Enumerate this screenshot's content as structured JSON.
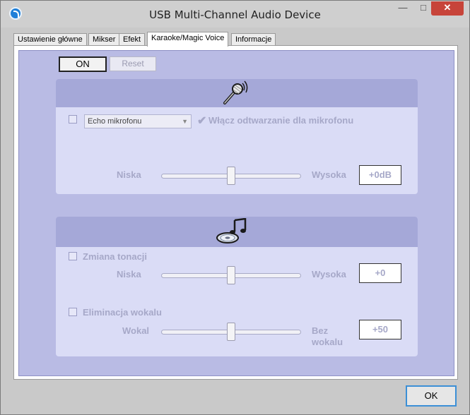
{
  "window": {
    "title": "USB Multi-Channel Audio Device",
    "minimize_glyph": "—",
    "maximize_glyph": "□",
    "close_glyph": "✕"
  },
  "tabs": [
    {
      "label": "Ustawienie główne",
      "active": false
    },
    {
      "label": "Mikser",
      "active": false
    },
    {
      "label": "Efekt",
      "active": false
    },
    {
      "label": "Karaoke/Magic Voice",
      "active": true
    },
    {
      "label": "Informacje",
      "active": false
    }
  ],
  "toolbar": {
    "on_label": "ON",
    "reset_label": "Reset"
  },
  "microphone_panel": {
    "icon": "microphone-icon",
    "echo_checked": false,
    "echo_select_value": "Echo mikrofonu",
    "playback_checked": true,
    "playback_label": "Włącz odtwarzanie dla mikrofonu",
    "slider_low_label": "Niska",
    "slider_high_label": "Wysoka",
    "slider_level": 0.5,
    "value_display": "+0dB"
  },
  "music_panel": {
    "icon": "music-cd-icon",
    "pitch_checked": false,
    "pitch_label": "Zmiana tonacji",
    "pitch_low_label": "Niska",
    "pitch_high_label": "Wysoka",
    "pitch_level": 0.5,
    "pitch_value": "+0",
    "vocal_checked": false,
    "vocal_label": "Eliminacja wokalu",
    "vocal_low_label": "Wokal",
    "vocal_high_label_1": "Bez",
    "vocal_high_label_2": "wokalu",
    "vocal_level": 0.5,
    "vocal_value": "+50"
  },
  "footer": {
    "ok_label": "OK"
  },
  "colors": {
    "accent": "#3c8fd6",
    "panel_header": "#a5a8d8",
    "panel_body": "#dadcf6",
    "content_bg": "#b9bbe4",
    "disabled_text": "#a6a8c8",
    "close_button": "#c7443a"
  }
}
